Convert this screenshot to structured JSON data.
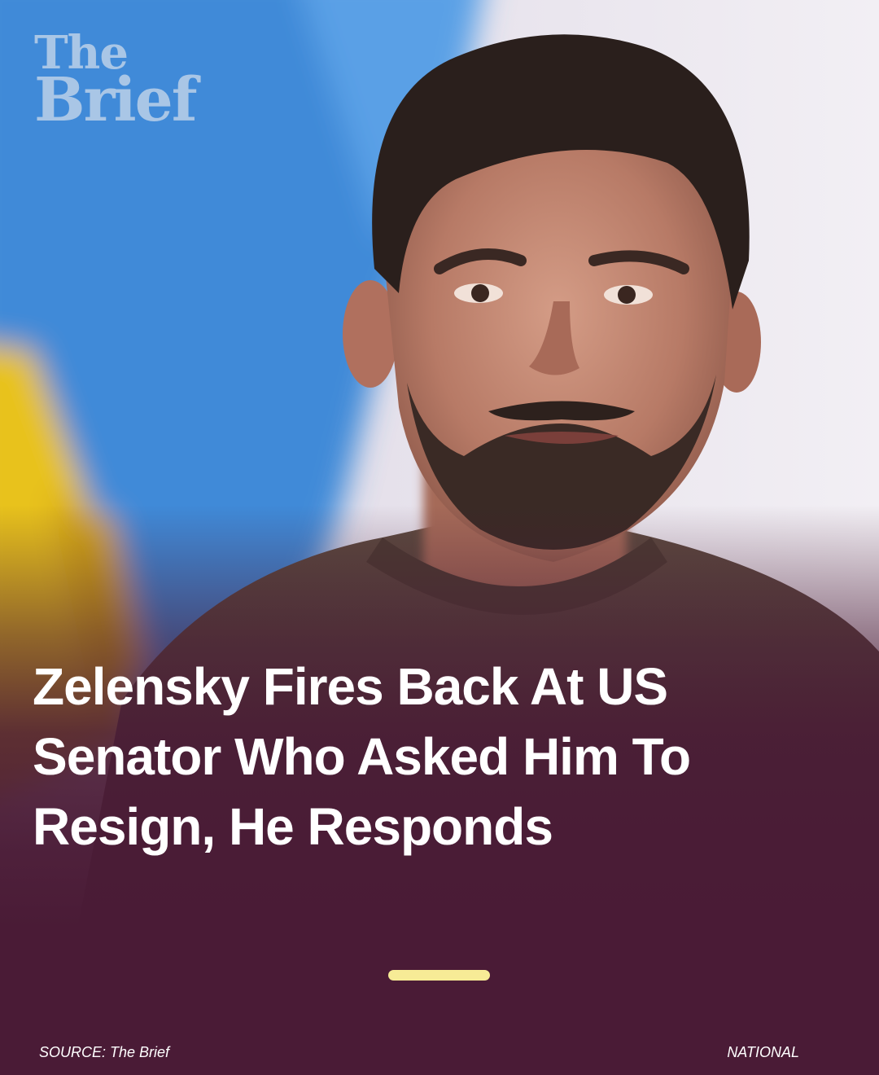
{
  "brand": {
    "logo_top": "The",
    "logo_bottom": "Brief",
    "logo_color": "#a9c6e6"
  },
  "headline": "Zelensky Fires Back At US Senator Who Asked Him To Resign, He Responds",
  "footer": {
    "source": "SOURCE: The Brief",
    "category": "NATIONAL"
  },
  "colors": {
    "background": "#4a1b36",
    "accent_bar": "#f7eb96",
    "flag_blue": "#3f8ad8",
    "flag_yellow": "#e8c21c"
  },
  "photo": {
    "description_icon": "portrait-photo"
  }
}
